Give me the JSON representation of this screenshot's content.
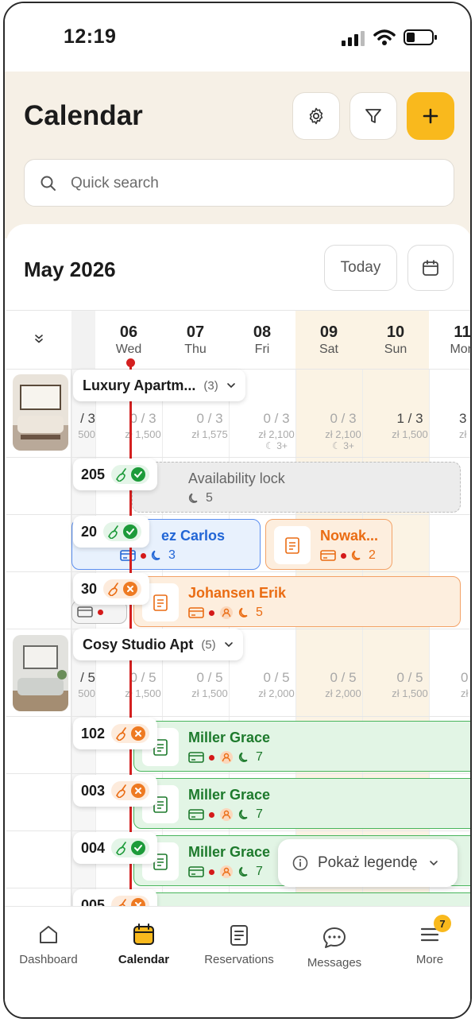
{
  "status": {
    "time": "12:19"
  },
  "header": {
    "title": "Calendar"
  },
  "search": {
    "placeholder": "Quick search"
  },
  "calendar": {
    "month": "May 2026",
    "today_label": "Today",
    "days": [
      {
        "num": "06",
        "dow": "Wed"
      },
      {
        "num": "07",
        "dow": "Thu"
      },
      {
        "num": "08",
        "dow": "Fri"
      },
      {
        "num": "09",
        "dow": "Sat"
      },
      {
        "num": "10",
        "dow": "Sun"
      },
      {
        "num": "11",
        "dow": "Mon"
      }
    ],
    "groups": [
      {
        "name": "Luxury Apartm...",
        "count": "(3)",
        "avail": [
          {
            "a": "/ 3",
            "p": "500"
          },
          {
            "a": "0 / 3",
            "p": "zł 1,500"
          },
          {
            "a": "0 / 3",
            "p": "zł 1,575"
          },
          {
            "a": "0 / 3",
            "p": "zł 2,100",
            "m": "☾ 3+"
          },
          {
            "a": "0 / 3",
            "p": "zł 2,100",
            "m": "☾ 3+"
          },
          {
            "a": "1 / 3",
            "p": "zł 1,500"
          },
          {
            "a": "3",
            "p": "zł 1,5"
          }
        ]
      },
      {
        "name": "Cosy Studio Apt",
        "count": "(5)",
        "avail": [
          {
            "a": "/ 5",
            "p": "500"
          },
          {
            "a": "0 / 5",
            "p": "zł 1,500"
          },
          {
            "a": "0 / 5",
            "p": "zł 1,500"
          },
          {
            "a": "0 / 5",
            "p": "zł 2,000"
          },
          {
            "a": "0 / 5",
            "p": "zł 2,000"
          },
          {
            "a": "0 / 5",
            "p": "zł 1,500"
          },
          {
            "a": "0",
            "p": "zł 1,5"
          }
        ]
      }
    ],
    "units": [
      {
        "label": "205"
      },
      {
        "label": "20"
      },
      {
        "label": "30"
      },
      {
        "label": "102"
      },
      {
        "label": "003"
      },
      {
        "label": "004"
      },
      {
        "label": "005"
      }
    ],
    "reservations": [
      {
        "name": "Availability lock",
        "nights": "5"
      },
      {
        "name": "ez Carlos",
        "nights": "3"
      },
      {
        "name": "Nowak...",
        "nights": "2"
      },
      {
        "name": "Johansen Erik",
        "nights": "5"
      },
      {
        "name": "Miller Grace",
        "nights": "7"
      },
      {
        "name": "Miller Grace",
        "nights": "7"
      },
      {
        "name": "Miller Grace",
        "nights": "7"
      }
    ]
  },
  "legend": {
    "label": "Pokaż legendę"
  },
  "tabs": [
    {
      "label": "Dashboard",
      "icon": "home-icon"
    },
    {
      "label": "Calendar",
      "icon": "calendar-icon"
    },
    {
      "label": "Reservations",
      "icon": "clipboard-icon"
    },
    {
      "label": "Messages",
      "icon": "chat-icon"
    },
    {
      "label": "More",
      "icon": "menu-icon",
      "badge": "7"
    }
  ],
  "colors": {
    "accent": "#f9b91d",
    "header_bg": "#f6f0e6",
    "weekend_bg": "#fbf3e4",
    "now_line": "#d42020",
    "blue": "#2266d6",
    "orange": "#ea6c13",
    "green": "#1d7a2c"
  }
}
